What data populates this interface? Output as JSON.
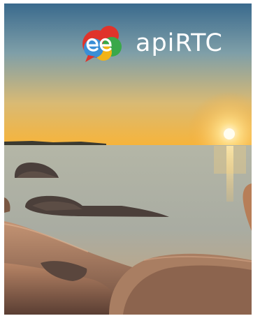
{
  "app": {
    "brand_name": "apiRTC",
    "logo_icon": "apirtc-logo-icon"
  },
  "colors": {
    "sky_top": "#3f6d8e",
    "sky_horizon": "#f3b34a",
    "sun": "#fff6c8",
    "sea": "#9aa8a8",
    "rock_dark": "#3a3230",
    "rock_light": "#b98c6c",
    "logo_red": "#e0332b",
    "logo_green": "#3aa84a",
    "logo_blue": "#3a8fd6",
    "logo_yellow": "#f2b316"
  }
}
